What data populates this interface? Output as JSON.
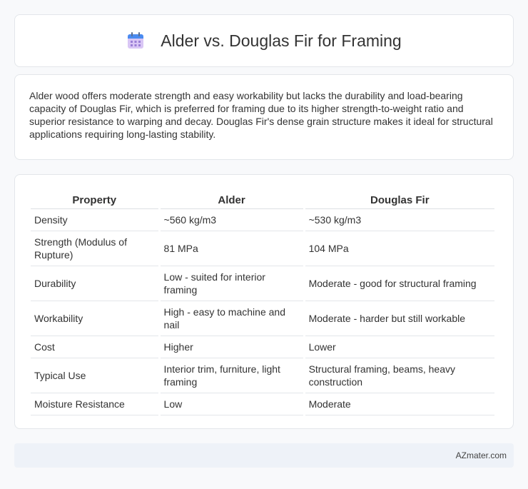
{
  "header": {
    "title": "Alder vs. Douglas Fir for Framing",
    "icon": "calendar-icon"
  },
  "summary": {
    "text": "Alder wood offers moderate strength and easy workability but lacks the durability and load-bearing capacity of Douglas Fir, which is preferred for framing due to its higher strength-to-weight ratio and superior resistance to warping and decay. Douglas Fir's dense grain structure makes it ideal for structural applications requiring long-lasting stability."
  },
  "table": {
    "headers": [
      "Property",
      "Alder",
      "Douglas Fir"
    ],
    "rows": [
      [
        "Density",
        "~560 kg/m3",
        "~530 kg/m3"
      ],
      [
        "Strength (Modulus of Rupture)",
        "81 MPa",
        "104 MPa"
      ],
      [
        "Durability",
        "Low - suited for interior framing",
        "Moderate - good for structural framing"
      ],
      [
        "Workability",
        "High - easy to machine and nail",
        "Moderate - harder but still workable"
      ],
      [
        "Cost",
        "Higher",
        "Lower"
      ],
      [
        "Typical Use",
        "Interior trim, furniture, light framing",
        "Structural framing, beams, heavy construction"
      ],
      [
        "Moisture Resistance",
        "Low",
        "Moderate"
      ]
    ]
  },
  "footer": {
    "text": "AZmater.com"
  },
  "colors": {
    "icon_top": "#4a8bf0",
    "icon_body": "#d9c6f5",
    "icon_grid": "#9b7fd6"
  }
}
